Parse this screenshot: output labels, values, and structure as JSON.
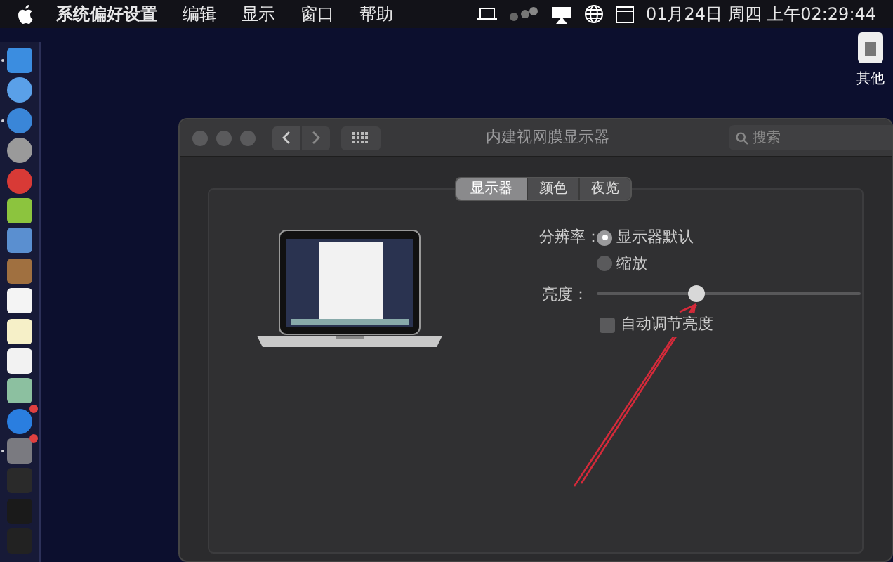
{
  "menu_bar": {
    "menus": [
      "系统偏好设置",
      "编辑",
      "显示",
      "窗口",
      "帮助"
    ],
    "clock": "01月24日 周四 上午02:29:44"
  },
  "dock": {
    "items": [
      {
        "running": true,
        "badge": false
      },
      {
        "running": false,
        "badge": false
      },
      {
        "running": true,
        "badge": false
      },
      {
        "running": false,
        "badge": false
      },
      {
        "running": false,
        "badge": false
      },
      {
        "running": false,
        "badge": false
      },
      {
        "running": false,
        "badge": false
      },
      {
        "running": false,
        "badge": false
      },
      {
        "running": false,
        "badge": false
      },
      {
        "running": false,
        "badge": false
      },
      {
        "running": false,
        "badge": false
      },
      {
        "running": false,
        "badge": false
      },
      {
        "running": false,
        "badge": true
      },
      {
        "running": true,
        "badge": true
      },
      {
        "running": false,
        "badge": false
      },
      {
        "running": false,
        "badge": false
      },
      {
        "running": false,
        "badge": false
      }
    ]
  },
  "desktop_icon": {
    "label": "其他"
  },
  "window": {
    "title": "内建视网膜显示器",
    "search": {
      "placeholder": "搜索"
    },
    "tabs": [
      {
        "label": "显示器",
        "selected": true
      },
      {
        "label": "颜色",
        "selected": false
      },
      {
        "label": "夜览",
        "selected": false
      }
    ],
    "resolution": {
      "label": "分辨率：",
      "options": [
        {
          "label": "显示器默认",
          "selected": true
        },
        {
          "label": "缩放",
          "selected": false
        }
      ]
    },
    "brightness": {
      "label": "亮度：",
      "level": 0.38
    },
    "auto_brightness": {
      "label": "自动调节亮度",
      "checked": false
    }
  }
}
